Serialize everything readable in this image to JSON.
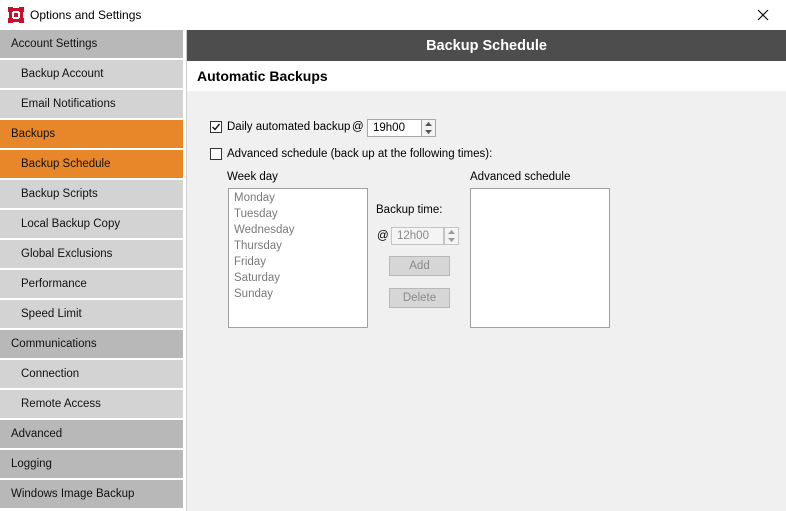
{
  "window": {
    "title": "Options and Settings"
  },
  "sidebar": {
    "items": [
      {
        "label": "Account Settings",
        "kind": "group"
      },
      {
        "label": "Backup Account",
        "kind": "sub"
      },
      {
        "label": "Email Notifications",
        "kind": "sub"
      },
      {
        "label": "Backups",
        "kind": "group",
        "active": true
      },
      {
        "label": "Backup Schedule",
        "kind": "sub",
        "active": true
      },
      {
        "label": "Backup Scripts",
        "kind": "sub"
      },
      {
        "label": "Local Backup Copy",
        "kind": "sub"
      },
      {
        "label": "Global Exclusions",
        "kind": "sub"
      },
      {
        "label": "Performance",
        "kind": "sub"
      },
      {
        "label": "Speed Limit",
        "kind": "sub"
      },
      {
        "label": "Communications",
        "kind": "group"
      },
      {
        "label": "Connection",
        "kind": "sub"
      },
      {
        "label": "Remote Access",
        "kind": "sub"
      },
      {
        "label": "Advanced",
        "kind": "group"
      },
      {
        "label": "Logging",
        "kind": "group"
      },
      {
        "label": "Windows Image Backup",
        "kind": "group"
      }
    ]
  },
  "header": {
    "title": "Backup Schedule"
  },
  "section": {
    "title": "Automatic Backups"
  },
  "daily": {
    "label": "Daily automated backup",
    "checked": true,
    "at": "@",
    "time": "19h00"
  },
  "advanced": {
    "label": "Advanced schedule (back up at the following times):",
    "checked": false,
    "weekday_label": "Week day",
    "weekdays": [
      "Monday",
      "Tuesday",
      "Wednesday",
      "Thursday",
      "Friday",
      "Saturday",
      "Sunday"
    ],
    "backup_time_label": "Backup time:",
    "at": "@",
    "time": "12h00",
    "add_label": "Add",
    "delete_label": "Delete",
    "schedule_label": "Advanced schedule"
  }
}
